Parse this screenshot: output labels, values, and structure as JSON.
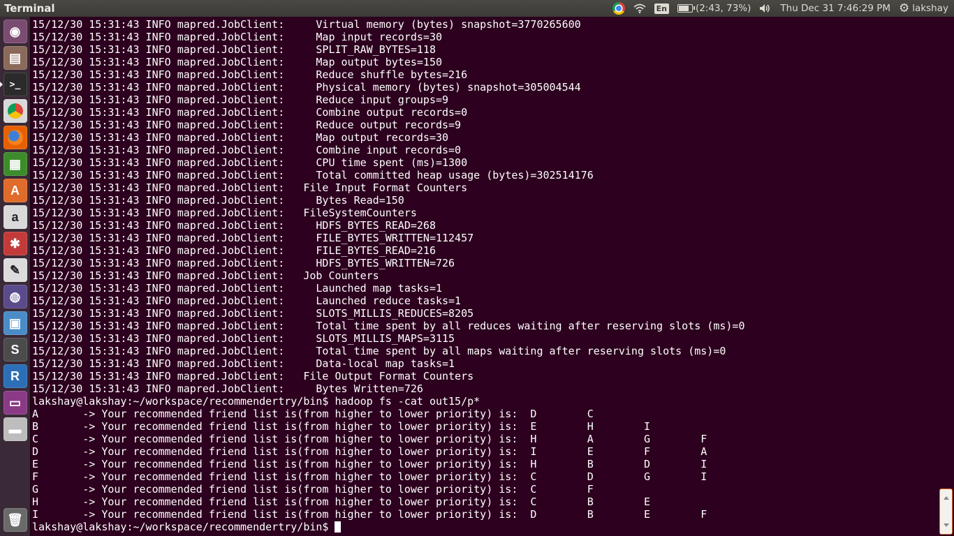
{
  "topbar": {
    "title": "Terminal",
    "battery": "(2:43, 73%)",
    "keyboard": "En",
    "clock": "Thu Dec 31  7:46:29 PM",
    "user": "lakshay",
    "icons": [
      "chrome-icon",
      "wifi-icon",
      "keyboard-layout-icon",
      "battery-icon",
      "volume-icon",
      "session-gear-icon"
    ]
  },
  "launcher": {
    "items": [
      {
        "name": "dash-home",
        "glyph": "◉",
        "bg": "#7b4c72"
      },
      {
        "name": "files",
        "glyph": "▤",
        "bg": "#8a6a5a"
      },
      {
        "name": "terminal",
        "glyph": ">_",
        "bg": "#2b2b2b",
        "active": true
      },
      {
        "name": "chrome",
        "glyph": "",
        "bg": "#d9d9d9"
      },
      {
        "name": "firefox",
        "glyph": "",
        "bg": "#e66000"
      },
      {
        "name": "libreoffice",
        "glyph": "▦",
        "bg": "#3c8c2c"
      },
      {
        "name": "software-center",
        "glyph": "A",
        "bg": "#e06b2a"
      },
      {
        "name": "amazon",
        "glyph": "a",
        "bg": "#d9d9d9"
      },
      {
        "name": "system-settings",
        "glyph": "✱",
        "bg": "#c23a3a"
      },
      {
        "name": "text-editor",
        "glyph": "✎",
        "bg": "#dcdcdc"
      },
      {
        "name": "eclipse",
        "glyph": "◍",
        "bg": "#5b4a8c"
      },
      {
        "name": "virtualbox",
        "glyph": "▣",
        "bg": "#4a8cc7"
      },
      {
        "name": "sublime-text",
        "glyph": "S",
        "bg": "#4b4b4b"
      },
      {
        "name": "rstudio",
        "glyph": "R",
        "bg": "#2c6fb6"
      },
      {
        "name": "workspace-switcher",
        "glyph": "▭",
        "bg": "#8a3a86"
      },
      {
        "name": "drive",
        "glyph": "▬",
        "bg": "#bdbdbd"
      }
    ],
    "trash": {
      "glyph": "🗑",
      "bg": "#6a6a6a"
    }
  },
  "terminal": {
    "lines": [
      "15/12/30 15:31:43 INFO mapred.JobClient:     Virtual memory (bytes) snapshot=3770265600",
      "15/12/30 15:31:43 INFO mapred.JobClient:     Map input records=30",
      "15/12/30 15:31:43 INFO mapred.JobClient:     SPLIT_RAW_BYTES=118",
      "15/12/30 15:31:43 INFO mapred.JobClient:     Map output bytes=150",
      "15/12/30 15:31:43 INFO mapred.JobClient:     Reduce shuffle bytes=216",
      "15/12/30 15:31:43 INFO mapred.JobClient:     Physical memory (bytes) snapshot=305004544",
      "15/12/30 15:31:43 INFO mapred.JobClient:     Reduce input groups=9",
      "15/12/30 15:31:43 INFO mapred.JobClient:     Combine output records=0",
      "15/12/30 15:31:43 INFO mapred.JobClient:     Reduce output records=9",
      "15/12/30 15:31:43 INFO mapred.JobClient:     Map output records=30",
      "15/12/30 15:31:43 INFO mapred.JobClient:     Combine input records=0",
      "15/12/30 15:31:43 INFO mapred.JobClient:     CPU time spent (ms)=1300",
      "15/12/30 15:31:43 INFO mapred.JobClient:     Total committed heap usage (bytes)=302514176",
      "15/12/30 15:31:43 INFO mapred.JobClient:   File Input Format Counters",
      "15/12/30 15:31:43 INFO mapred.JobClient:     Bytes Read=150",
      "15/12/30 15:31:43 INFO mapred.JobClient:   FileSystemCounters",
      "15/12/30 15:31:43 INFO mapred.JobClient:     HDFS_BYTES_READ=268",
      "15/12/30 15:31:43 INFO mapred.JobClient:     FILE_BYTES_WRITTEN=112457",
      "15/12/30 15:31:43 INFO mapred.JobClient:     FILE_BYTES_READ=216",
      "15/12/30 15:31:43 INFO mapred.JobClient:     HDFS_BYTES_WRITTEN=726",
      "15/12/30 15:31:43 INFO mapred.JobClient:   Job Counters",
      "15/12/30 15:31:43 INFO mapred.JobClient:     Launched map tasks=1",
      "15/12/30 15:31:43 INFO mapred.JobClient:     Launched reduce tasks=1",
      "15/12/30 15:31:43 INFO mapred.JobClient:     SLOTS_MILLIS_REDUCES=8205",
      "15/12/30 15:31:43 INFO mapred.JobClient:     Total time spent by all reduces waiting after reserving slots (ms)=0",
      "15/12/30 15:31:43 INFO mapred.JobClient:     SLOTS_MILLIS_MAPS=3115",
      "15/12/30 15:31:43 INFO mapred.JobClient:     Total time spent by all maps waiting after reserving slots (ms)=0",
      "15/12/30 15:31:43 INFO mapred.JobClient:     Data-local map tasks=1",
      "15/12/30 15:31:43 INFO mapred.JobClient:   File Output Format Counters",
      "15/12/30 15:31:43 INFO mapred.JobClient:     Bytes Written=726",
      "lakshay@lakshay:~/workspace/recommendertry/bin$ hadoop fs -cat out15/p*",
      "A       -> Your recommended friend list is(from higher to lower priority) is:  D        C",
      "B       -> Your recommended friend list is(from higher to lower priority) is:  E        H        I",
      "C       -> Your recommended friend list is(from higher to lower priority) is:  H        A        G        F",
      "D       -> Your recommended friend list is(from higher to lower priority) is:  I        E        F        A",
      "E       -> Your recommended friend list is(from higher to lower priority) is:  H        B        D        I",
      "F       -> Your recommended friend list is(from higher to lower priority) is:  C        D        G        I",
      "G       -> Your recommended friend list is(from higher to lower priority) is:  C        F",
      "H       -> Your recommended friend list is(from higher to lower priority) is:  C        B        E",
      "I       -> Your recommended friend list is(from higher to lower priority) is:  D        B        E        F"
    ],
    "prompt": "lakshay@lakshay:~/workspace/recommendertry/bin$ "
  }
}
